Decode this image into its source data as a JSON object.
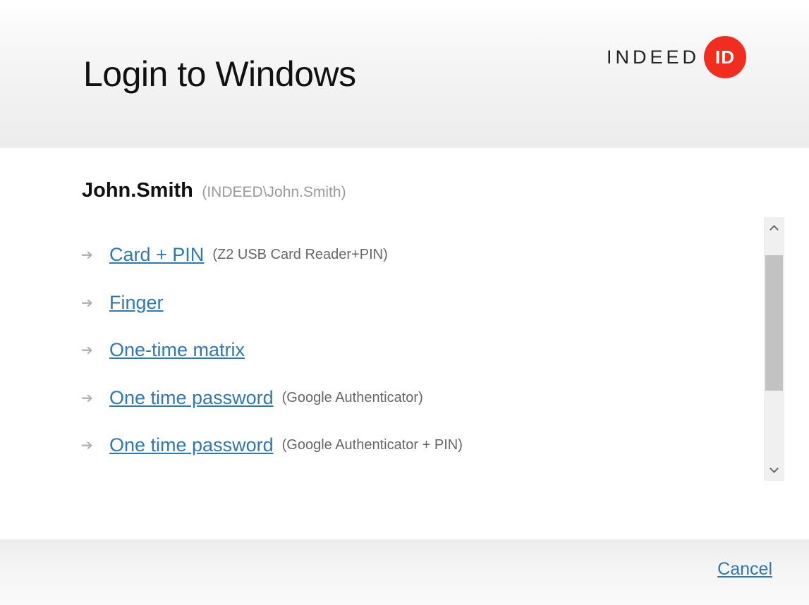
{
  "header": {
    "title": "Login to Windows",
    "logo_text": "INDEED",
    "logo_badge": "ID",
    "logo_color": "#f02d1e"
  },
  "user": {
    "name": "John.Smith",
    "domain": "(INDEED\\John.Smith)"
  },
  "methods": [
    {
      "label": "Card + PIN",
      "note": "(Z2 USB Card Reader+PIN)"
    },
    {
      "label": "Finger",
      "note": ""
    },
    {
      "label": "One-time matrix",
      "note": ""
    },
    {
      "label": "One time password",
      "note": "(Google Authenticator)"
    },
    {
      "label": "One time password",
      "note": "(Google Authenticator + PIN)"
    }
  ],
  "icons": {
    "method_arrow": "arrow-right-icon",
    "scroll_up": "chevron-up-icon",
    "scroll_down": "chevron-down-icon"
  },
  "footer": {
    "cancel_label": "Cancel"
  },
  "colors": {
    "link": "#2f78b2",
    "brand": "#f02d1e"
  }
}
